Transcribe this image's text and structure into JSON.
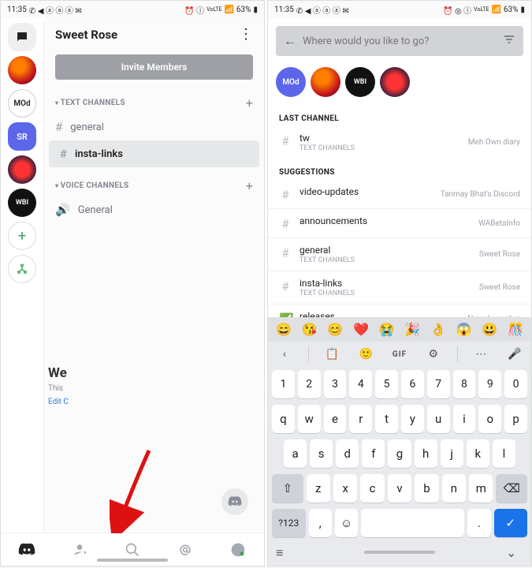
{
  "status": {
    "time": "11:35",
    "battery": "63%",
    "net": "VoLTE"
  },
  "leftPanel": {
    "title": "Sweet Rose",
    "invite": "Invite Members",
    "sections": {
      "text": "TEXT CHANNELS",
      "voice": "VOICE CHANNELS"
    },
    "textChannels": [
      "general",
      "insta-links"
    ],
    "voiceChannels": [
      "General"
    ],
    "serverLabels": {
      "mod": "MOd",
      "sr": "SR",
      "wbi": "WBI"
    }
  },
  "welcome": {
    "title": "We",
    "sub": "This",
    "link": "Edit C"
  },
  "search": {
    "placeholder": "Where would you like to go?"
  },
  "avatarLabels": {
    "mod": "MOd",
    "wbi": "WBI"
  },
  "sections": {
    "last": "LAST CHANNEL",
    "sugg": "SUGGESTIONS"
  },
  "last": {
    "name": "tw",
    "sub": "TEXT CHANNELS",
    "right": "Meh Own diary"
  },
  "suggestions": [
    {
      "name": "video-updates",
      "sub": "",
      "right": "Tanmay Bhat's Discord"
    },
    {
      "name": "announcements",
      "sub": "",
      "right": "WABetaInfo"
    },
    {
      "name": "general",
      "sub": "TEXT CHANNELS",
      "right": "Sweet Rose"
    },
    {
      "name": "insta-links",
      "sub": "TEXT CHANNELS",
      "right": "Sweet Rose"
    },
    {
      "name": "releases",
      "sub": "",
      "right": "Nova Launcher",
      "check": true
    }
  ],
  "kbd": {
    "emojis": [
      "😄",
      "😘",
      "😊",
      "❤️",
      "😭",
      "🎉",
      "👌",
      "😱",
      "😃",
      "🎊"
    ],
    "gif": "GIF",
    "nums": [
      "1",
      "2",
      "3",
      "4",
      "5",
      "6",
      "7",
      "8",
      "9",
      "0"
    ],
    "r1": [
      "q",
      "w",
      "e",
      "r",
      "t",
      "y",
      "u",
      "i",
      "o",
      "p"
    ],
    "r2": [
      "a",
      "s",
      "d",
      "f",
      "g",
      "h",
      "j",
      "k",
      "l"
    ],
    "r3": [
      "z",
      "x",
      "c",
      "v",
      "b",
      "n",
      "m"
    ],
    "sym": "?123",
    "comma": ",",
    "dot": "."
  }
}
